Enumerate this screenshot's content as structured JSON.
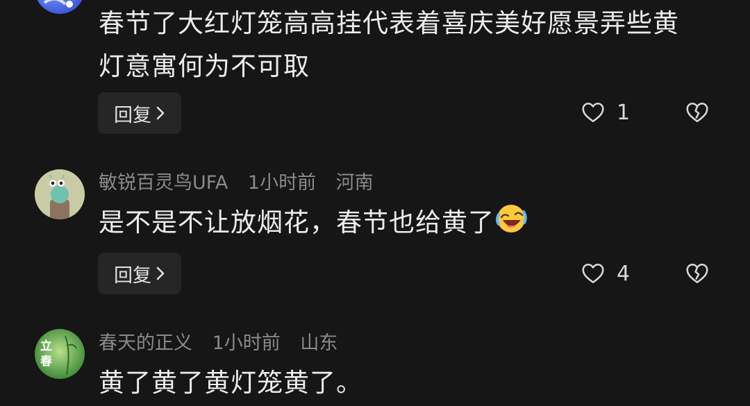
{
  "comments": [
    {
      "text_line1": "春节了大红灯笼高高挂代表着喜庆美好愿景弄些黄",
      "text_line2": "灯意寓何为不可取",
      "reply_label": "回复",
      "likes": "1"
    },
    {
      "username": "敏锐百灵鸟UFA",
      "time": "1小时前",
      "location": "河南",
      "text": "是不是不让放烟花，春节也给黄了",
      "emoji": "laughing-crying-face",
      "reply_label": "回复",
      "likes": "4"
    },
    {
      "username": "春天的正义",
      "time": "1小时前",
      "location": "山东",
      "avatar_text": "立春",
      "text": "黄了黄了黄灯笼黄了。"
    }
  ],
  "icons": {
    "like": "heart-outline-icon",
    "dislike": "broken-heart-icon",
    "chevron": "chevron-right-icon"
  },
  "colors": {
    "background": "#161616",
    "text": "#ececec",
    "meta": "#8a8a8a",
    "button_bg": "#262626"
  }
}
